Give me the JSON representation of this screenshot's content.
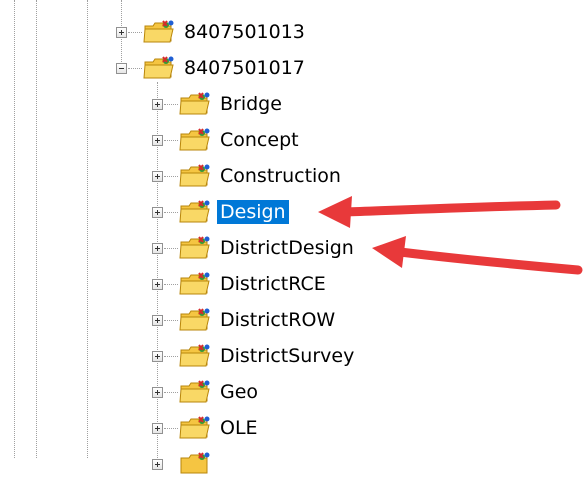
{
  "tree": {
    "parents": [
      {
        "label": "8407501013",
        "expanded": false
      },
      {
        "label": "8407501017",
        "expanded": true
      }
    ],
    "children": [
      {
        "label": "Bridge",
        "selected": false
      },
      {
        "label": "Concept",
        "selected": false
      },
      {
        "label": "Construction",
        "selected": false
      },
      {
        "label": "Design",
        "selected": true
      },
      {
        "label": "DistrictDesign",
        "selected": false
      },
      {
        "label": "DistrictRCE",
        "selected": false
      },
      {
        "label": "DistrictROW",
        "selected": false
      },
      {
        "label": "DistrictSurvey",
        "selected": false
      },
      {
        "label": "Geo",
        "selected": false
      },
      {
        "label": "OLE",
        "selected": false
      }
    ]
  },
  "colors": {
    "selection": "#0078d7",
    "arrow": "#e8393a",
    "folder": "#f5c542"
  },
  "icons": {
    "expander_collapsed": "plus-box-icon",
    "expander_expanded": "minus-box-icon",
    "folder": "shared-folder-icon"
  }
}
